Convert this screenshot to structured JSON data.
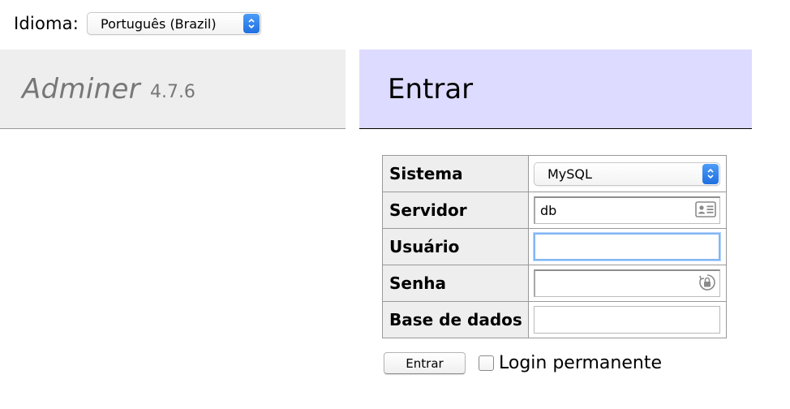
{
  "language": {
    "label": "Idioma:",
    "selected": "Português (Brazil)"
  },
  "brand": {
    "name": "Adminer",
    "version": "4.7.6"
  },
  "page": {
    "title": "Entrar"
  },
  "form": {
    "rows": [
      {
        "label": "Sistema",
        "value": "MySQL",
        "type": "select"
      },
      {
        "label": "Servidor",
        "value": "db",
        "type": "text"
      },
      {
        "label": "Usuário",
        "value": "",
        "type": "text"
      },
      {
        "label": "Senha",
        "value": "",
        "type": "password"
      },
      {
        "label": "Base de dados",
        "value": "",
        "type": "text"
      }
    ],
    "submit_label": "Entrar",
    "permanent_login_label": "Login permanente",
    "permanent_login_checked": false
  },
  "colors": {
    "brand_strip_bg": "#eeeeee",
    "title_strip_bg": "#dddbff",
    "label_cell_bg": "#eeeeee",
    "focus_ring": "#82b6f3",
    "select_stepper": "#1f6fe0"
  },
  "icons": {
    "language_select": "chevron-up-down-icon",
    "system_select": "chevron-up-down-icon",
    "server_field": "contact-card-icon",
    "password_field": "keychain-lock-icon"
  }
}
